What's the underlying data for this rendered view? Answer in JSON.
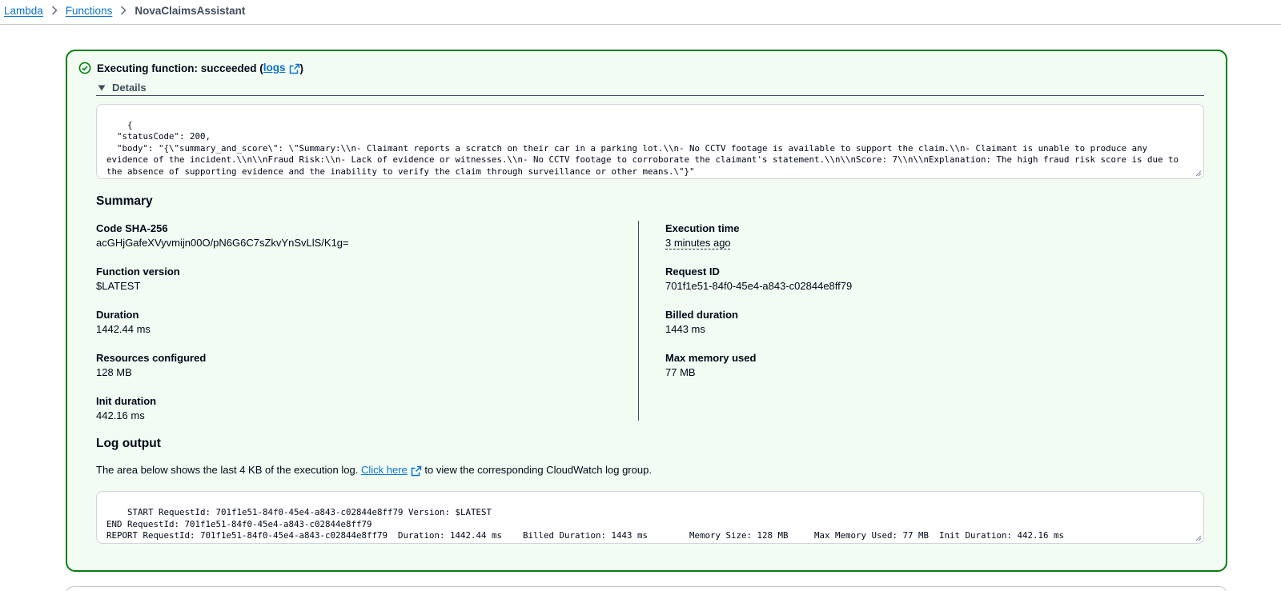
{
  "breadcrumb": {
    "items": [
      "Lambda",
      "Functions"
    ],
    "current": "NovaClaimsAssistant"
  },
  "alert": {
    "status_prefix": "Executing function: succeeded (",
    "logs_link": "logs",
    "status_suffix": ")",
    "details_label": "Details",
    "response_json": "{\n  \"statusCode\": 200,\n  \"body\": \"{\\\"summary_and_score\\\": \\\"Summary:\\\\n- Claimant reports a scratch on their car in a parking lot.\\\\n- No CCTV footage is available to support the claim.\\\\n- Claimant is unable to produce any evidence of the incident.\\\\n\\\\nFraud Risk:\\\\n- Lack of evidence or witnesses.\\\\n- No CCTV footage to corroborate the claimant's statement.\\\\n\\\\nScore: 7\\\\n\\\\nExplanation: The high fraud risk score is due to the absence of supporting evidence and the inability to verify the claim through surveillance or other means.\\\"}\"\n}"
  },
  "summary": {
    "title": "Summary",
    "left": [
      {
        "label": "Code SHA-256",
        "value": "acGHjGafeXVyvmijn00O/pN6G6C7sZkvYnSvLlS/K1g="
      },
      {
        "label": "Function version",
        "value": "$LATEST"
      },
      {
        "label": "Duration",
        "value": "1442.44 ms"
      },
      {
        "label": "Resources configured",
        "value": "128 MB"
      },
      {
        "label": "Init duration",
        "value": "442.16 ms"
      }
    ],
    "right": [
      {
        "label": "Execution time",
        "value": "3 minutes ago"
      },
      {
        "label": "Request ID",
        "value": "701f1e51-84f0-45e4-a843-c02844e8ff79"
      },
      {
        "label": "Billed duration",
        "value": "1443 ms"
      },
      {
        "label": "Max memory used",
        "value": "77 MB"
      }
    ]
  },
  "log_output": {
    "title": "Log output",
    "desc_prefix": "The area below shows the last 4 KB of the execution log.",
    "click_here": "Click here",
    "desc_suffix": "to view the corresponding CloudWatch log group.",
    "log_text": "START RequestId: 701f1e51-84f0-45e4-a843-c02844e8ff79 Version: $LATEST\nEND RequestId: 701f1e51-84f0-45e4-a843-c02844e8ff79\nREPORT RequestId: 701f1e51-84f0-45e4-a843-c02844e8ff79  Duration: 1442.44 ms    Billed Duration: 1443 ms        Memory Size: 128 MB     Max Memory Used: 77 MB  Init Duration: 442.16 ms"
  },
  "colors": {
    "link": "#0972d3",
    "success_border": "#037f0c",
    "success_bg": "#f2fcf3"
  }
}
